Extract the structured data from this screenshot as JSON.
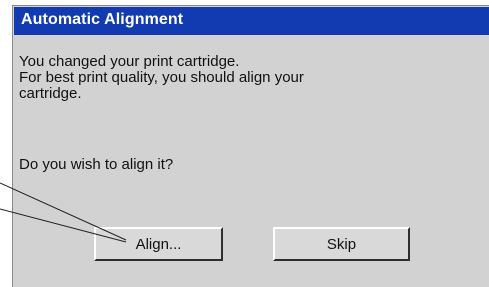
{
  "dialog": {
    "title": "Automatic Alignment",
    "message_lines": [
      "You changed your print cartridge.",
      "For best print quality, you should align your",
      "cartridge."
    ],
    "question": "Do you wish to align it?",
    "buttons": {
      "align_label": "Align...",
      "skip_label": "Skip"
    }
  },
  "colors": {
    "titlebar": "#123bb2",
    "dialog_background": "#d2d2d2"
  }
}
